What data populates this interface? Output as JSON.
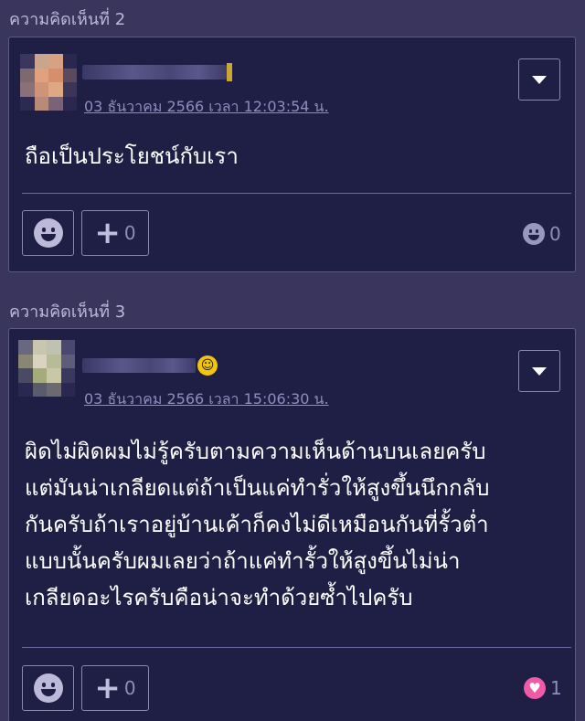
{
  "comments": [
    {
      "section_label": "ความคิดเห็นที่ 2",
      "datetime": "03 ธันวาคม 2566 เวลา 12:03:54 น.",
      "body_lines": [
        "ถือเป็นประโยชน์กับเรา"
      ],
      "plus_count": "0",
      "reaction_icon": "neutral-smiley-icon",
      "reaction_count": "0"
    },
    {
      "section_label": "ความคิดเห็นที่ 3",
      "datetime": "03 ธันวาคม 2566 เวลา 15:06:30 น.",
      "body_lines": [
        "ผิดไม่ผิดผมไม่รู้ครับตามความเห็นด้านบนเลยครับ",
        "แต่มันน่าเกลียดแต่ถ้าเป็นแค่ทำรั่วให้สูงขึ้นนึกกลับ",
        "กันครับถ้าเราอยู่บ้านเค้าก็คงไม่ดีเหมือนกันที่รั้วต่ำ",
        "แบบนั้นครับผมเลยว่าถ้าแค่ทำรั้วให้สูงขึ้นไม่น่า",
        "เกลียดอะไรครับคือน่าจะทำด้วยซ้ำไปครับ"
      ],
      "plus_count": "0",
      "reaction_icon": "heart-icon",
      "reaction_count": "1"
    }
  ],
  "colors": {
    "background": "#39355c",
    "card": "#1f1e45",
    "heart": "#f05aa6",
    "link": "#8f8dbd"
  }
}
